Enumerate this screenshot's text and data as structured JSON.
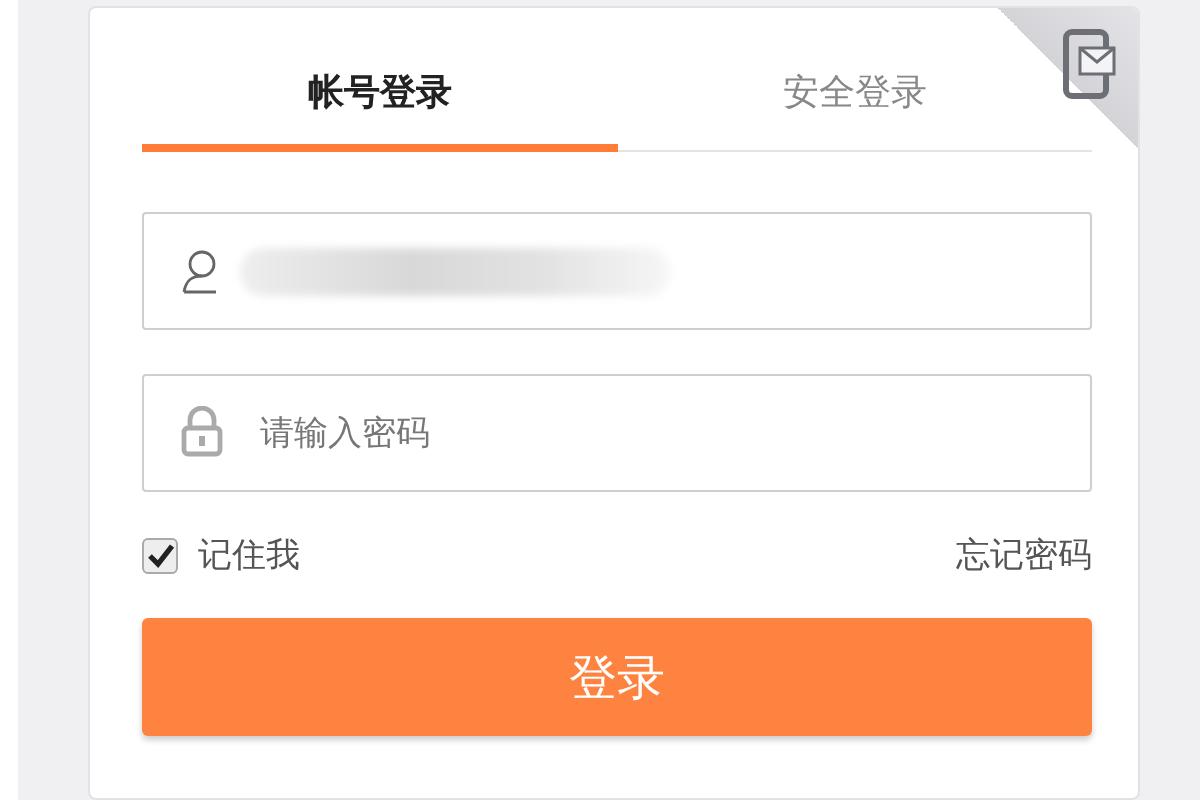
{
  "tabs": [
    {
      "label": "帐号登录",
      "selected": true
    },
    {
      "label": "安全登录",
      "selected": false
    }
  ],
  "username": {
    "redacted": true
  },
  "password": {
    "placeholder": "请输入密码"
  },
  "remember": {
    "label": "记住我",
    "checked": true
  },
  "forgot_link": "忘记密码",
  "login_button": "登录"
}
